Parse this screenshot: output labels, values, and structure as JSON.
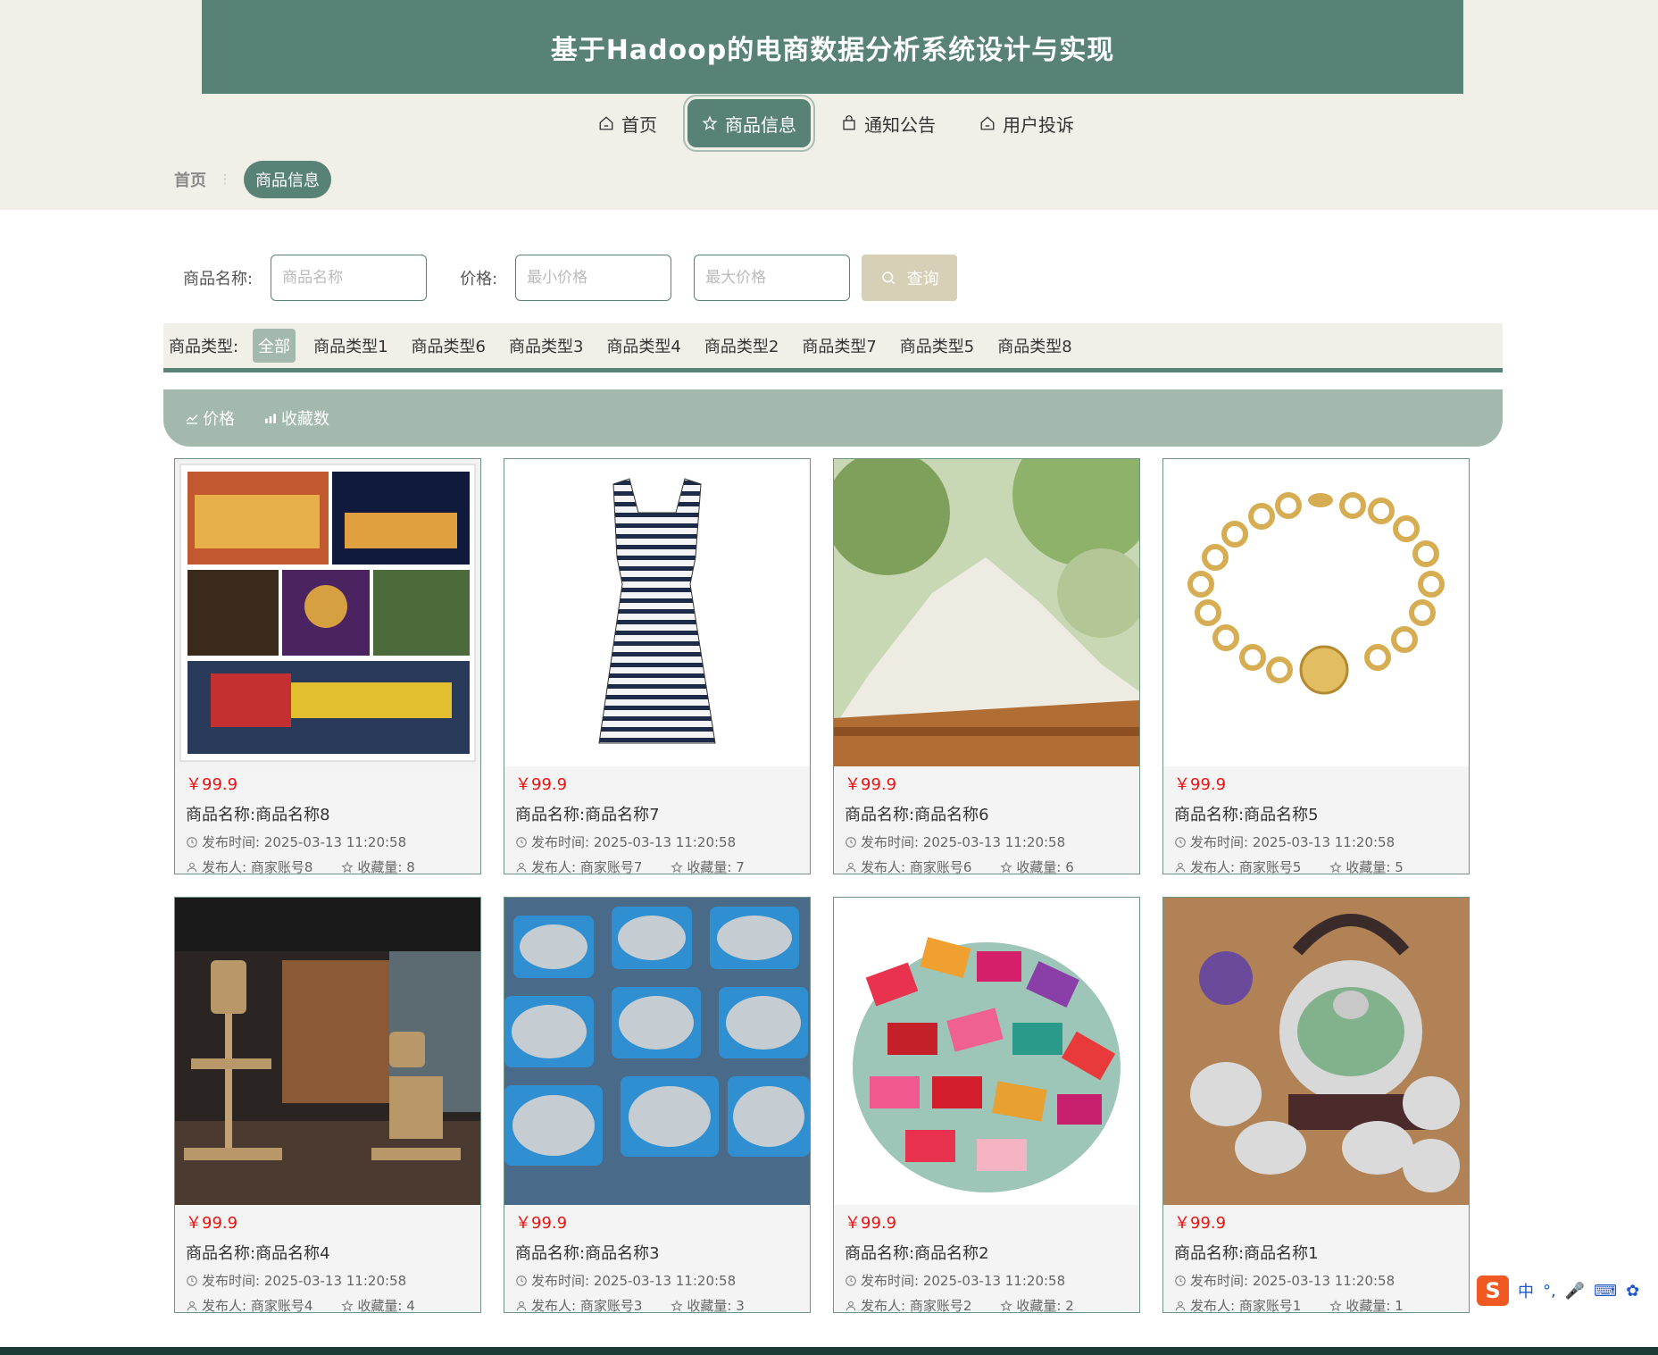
{
  "header": {
    "title": "基于Hadoop的电商数据分析系统设计与实现"
  },
  "nav": [
    {
      "label": "首页",
      "icon": "home-icon"
    },
    {
      "label": "商品信息",
      "icon": "star-icon",
      "active": true
    },
    {
      "label": "通知公告",
      "icon": "bag-icon"
    },
    {
      "label": "用户投诉",
      "icon": "home-icon"
    }
  ],
  "breadcrumb": {
    "home": "首页",
    "current": "商品信息"
  },
  "search": {
    "name_label": "商品名称:",
    "name_placeholder": "商品名称",
    "price_label": "价格:",
    "min_placeholder": "最小价格",
    "max_placeholder": "最大价格",
    "button": "查询"
  },
  "types": {
    "label": "商品类型:",
    "items": [
      "全部",
      "商品类型1",
      "商品类型6",
      "商品类型3",
      "商品类型4",
      "商品类型2",
      "商品类型7",
      "商品类型5",
      "商品类型8"
    ]
  },
  "sort": {
    "price": "价格",
    "favorites": "收藏数"
  },
  "products": [
    {
      "price": "￥99.9",
      "name": "商品名称:商品名称8",
      "time": "发布时间:  2025-03-13 11:20:58",
      "publisher": "发布人:  商家账号8",
      "favorites": "收藏量:  8",
      "image": "shopping-mall-collage"
    },
    {
      "price": "￥99.9",
      "name": "商品名称:商品名称7",
      "time": "发布时间:  2025-03-13 11:20:58",
      "publisher": "发布人:  商家账号7",
      "favorites": "收藏量:  7",
      "image": "striped-dress"
    },
    {
      "price": "￥99.9",
      "name": "商品名称:商品名称6",
      "time": "发布时间:  2025-03-13 11:20:58",
      "publisher": "发布人:  商家账号6",
      "favorites": "收藏量:  6",
      "image": "flour-bowl"
    },
    {
      "price": "￥99.9",
      "name": "商品名称:商品名称5",
      "time": "发布时间:  2025-03-13 11:20:58",
      "publisher": "发布人:  商家账号5",
      "favorites": "收藏量:  5",
      "image": "gold-bracelet"
    },
    {
      "price": "￥99.9",
      "name": "商品名称:商品名称4",
      "time": "发布时间:  2025-03-13 11:20:58",
      "publisher": "发布人:  商家账号4",
      "favorites": "收藏量:  4",
      "image": "cat-tree-room"
    },
    {
      "price": "￥99.9",
      "name": "商品名称:商品名称3",
      "time": "发布时间:  2025-03-13 11:20:58",
      "publisher": "发布人:  商家账号3",
      "favorites": "收藏量:  3",
      "image": "packaged-fish"
    },
    {
      "price": "￥99.9",
      "name": "商品名称:商品名称2",
      "time": "发布时间:  2025-03-13 11:20:58",
      "publisher": "发布人:  商家账号2",
      "favorites": "收藏量:  2",
      "image": "candy-pile"
    },
    {
      "price": "￥99.9",
      "name": "商品名称:商品名称1",
      "time": "发布时间:  2025-03-13 11:20:58",
      "publisher": "发布人:  商家账号1",
      "favorites": "收藏量:  1",
      "image": "silver-teapot-set"
    }
  ],
  "ime": {
    "logo": "S",
    "mode": "中"
  },
  "colors": {
    "primary": "#588275",
    "light": "#a4b9ae",
    "beige": "#f1f0e8",
    "button": "#d6d0b6",
    "price": "#ee1111"
  }
}
